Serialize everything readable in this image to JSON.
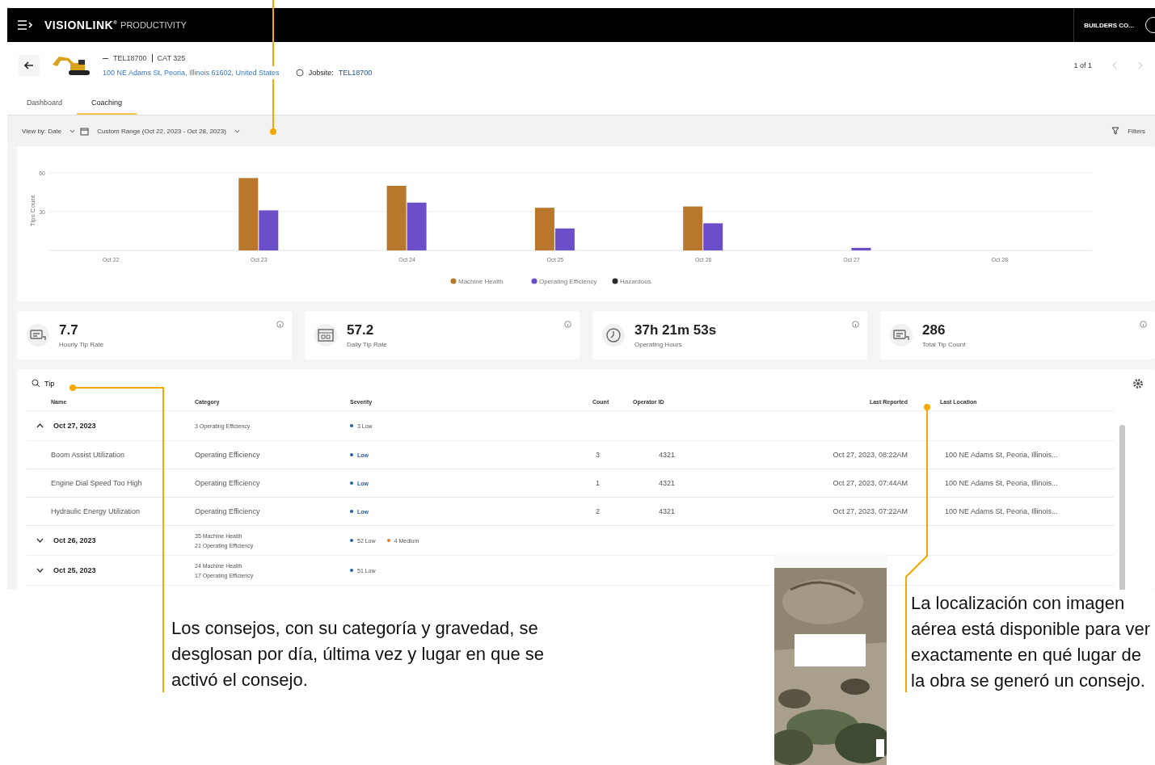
{
  "top_bar": {
    "brand": "VISIONLINK",
    "brand_mark": "®",
    "product": "PRODUCTIVITY",
    "account": "BUILDERS CO..."
  },
  "asset": {
    "id": "TEL18700",
    "model": "CAT 325",
    "address": "100 NE Adams St, Peoria, Illinois 61602, United States",
    "jobsite_label": "Jobsite:",
    "jobsite": "TEL18700",
    "pager": "1 of 1"
  },
  "tabs": [
    {
      "label": "Dashboard",
      "selected": false
    },
    {
      "label": "Coaching",
      "selected": true
    }
  ],
  "filter_bar": {
    "view_by": "View by: Date",
    "range": "Custom Range (Oct 22, 2023 - Oct 28, 2023)",
    "filters": "Filters"
  },
  "chart_data": {
    "type": "bar",
    "ylabel": "Tips Count",
    "categories": [
      "Oct 22",
      "Oct 23",
      "Oct 24",
      "Oct 25",
      "Oct 26",
      "Oct 27",
      "Oct 28"
    ],
    "ylim": [
      0,
      60
    ],
    "yticks": [
      30,
      60
    ],
    "legend": "bottom",
    "series": [
      {
        "name": "Machine Health",
        "color": "#b8772a",
        "values": [
          0,
          56,
          50,
          33,
          34,
          0,
          0
        ]
      },
      {
        "name": "Operating Efficiency",
        "color": "#6a4fc8",
        "values": [
          0,
          31,
          37,
          17,
          21,
          2,
          0
        ]
      },
      {
        "name": "Hazardous",
        "color": "#2b2b2b",
        "values": [
          0,
          0,
          0,
          0,
          0,
          0,
          0
        ]
      }
    ]
  },
  "stats": [
    {
      "kind": "tips",
      "value": "7.7",
      "label": "Hourly Tip Rate"
    },
    {
      "kind": "calendar",
      "value": "57.2",
      "label": "Daily Tip Rate"
    },
    {
      "kind": "clock",
      "value": "**37**h **21**m **53**s",
      "label": "Operating Hours"
    },
    {
      "kind": "tips",
      "value": "286",
      "label": "Total Tip Count"
    }
  ],
  "table": {
    "search": {
      "value": "Tip"
    },
    "columns": [
      "Name",
      "Category",
      "Severity",
      "Count",
      "Operator ID",
      "Last Reported",
      "Last Location"
    ],
    "groups": [
      {
        "date": "Oct 27, 2023",
        "expanded": true,
        "categories": [
          "3 Operating Efficiency"
        ],
        "severity": [
          {
            "text": "3 Low",
            "color": "#1f5fa8"
          }
        ],
        "rows": [
          {
            "name": "Boom Assist Utilization",
            "category": "Operating Efficiency",
            "severity": "Low",
            "color": "#1f5fa8",
            "count": "3",
            "operator": "4321",
            "last_reported": "Oct 27, 2023, 08:22AM",
            "location": "100 NE Adams St, Peoria, Illinois..."
          },
          {
            "name": "Engine Dial Speed Too High",
            "category": "Operating Efficiency",
            "severity": "Low",
            "color": "#1f5fa8",
            "count": "1",
            "operator": "4321",
            "last_reported": "Oct 27, 2023, 07:44AM",
            "location": "100 NE Adams St, Peoria, Illinois..."
          },
          {
            "name": "Hydraulic Energy Utilization",
            "category": "Operating Efficiency",
            "severity": "Low",
            "color": "#1f5fa8",
            "count": "2",
            "operator": "4321",
            "last_reported": "Oct 27, 2023, 07:22AM",
            "location": "100 NE Adams St, Peoria, Illinois..."
          }
        ]
      },
      {
        "date": "Oct 26, 2023",
        "expanded": false,
        "categories": [
          "35 Machine Health",
          "21 Operating Efficiency"
        ],
        "severity": [
          {
            "text": "52 Low",
            "color": "#1f5fa8"
          },
          {
            "text": "4 Medium",
            "color": "#e07b24"
          }
        ]
      },
      {
        "date": "Oct 25, 2023",
        "expanded": false,
        "categories": [
          "24 Machine Health",
          "17 Operating Efficiency"
        ],
        "severity": [
          {
            "text": "51 Low",
            "color": "#1f5fa8"
          }
        ]
      }
    ]
  },
  "annotations": [
    {
      "text": "Los consejos, con su categoría y gravedad, se desglosan por día, última vez y lugar en que se activó el consejo."
    },
    {
      "text": "La localización con imagen aérea está disponible para ver exactamente en qué lugar de la obra se generó un consejo."
    }
  ]
}
